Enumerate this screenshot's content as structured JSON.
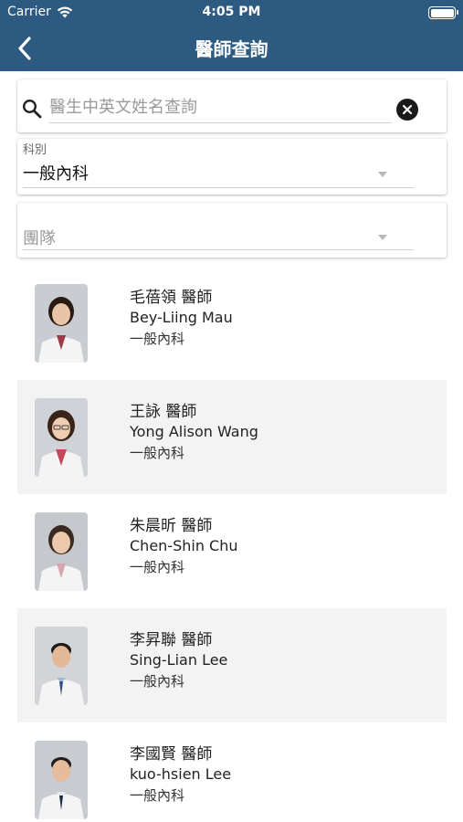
{
  "status_bar": {
    "carrier": "Carrier",
    "time": "4:05 PM"
  },
  "nav": {
    "title": "醫師查詢",
    "back_icon": "chevron-left-icon"
  },
  "search": {
    "placeholder": "醫生中英文姓名查詢",
    "value": ""
  },
  "department": {
    "label": "科別",
    "value": "一般內科"
  },
  "team": {
    "placeholder": "團隊"
  },
  "doctors": [
    {
      "name": "毛蓓領 醫師",
      "en_name": "Bey-Liing Mau",
      "dept": "一般內科"
    },
    {
      "name": "王詠 醫師",
      "en_name": "Yong Alison Wang",
      "dept": "一般內科"
    },
    {
      "name": "朱晨昕 醫師",
      "en_name": "Chen-Shin Chu",
      "dept": "一般內科"
    },
    {
      "name": "李昇聯 醫師",
      "en_name": "Sing-Lian Lee",
      "dept": "一般內科"
    },
    {
      "name": "李國賢 醫師",
      "en_name": "kuo-hsien Lee",
      "dept": "一般內科"
    }
  ],
  "colors": {
    "header": "#2c5a81",
    "row_alt": "#f3f3f3"
  }
}
